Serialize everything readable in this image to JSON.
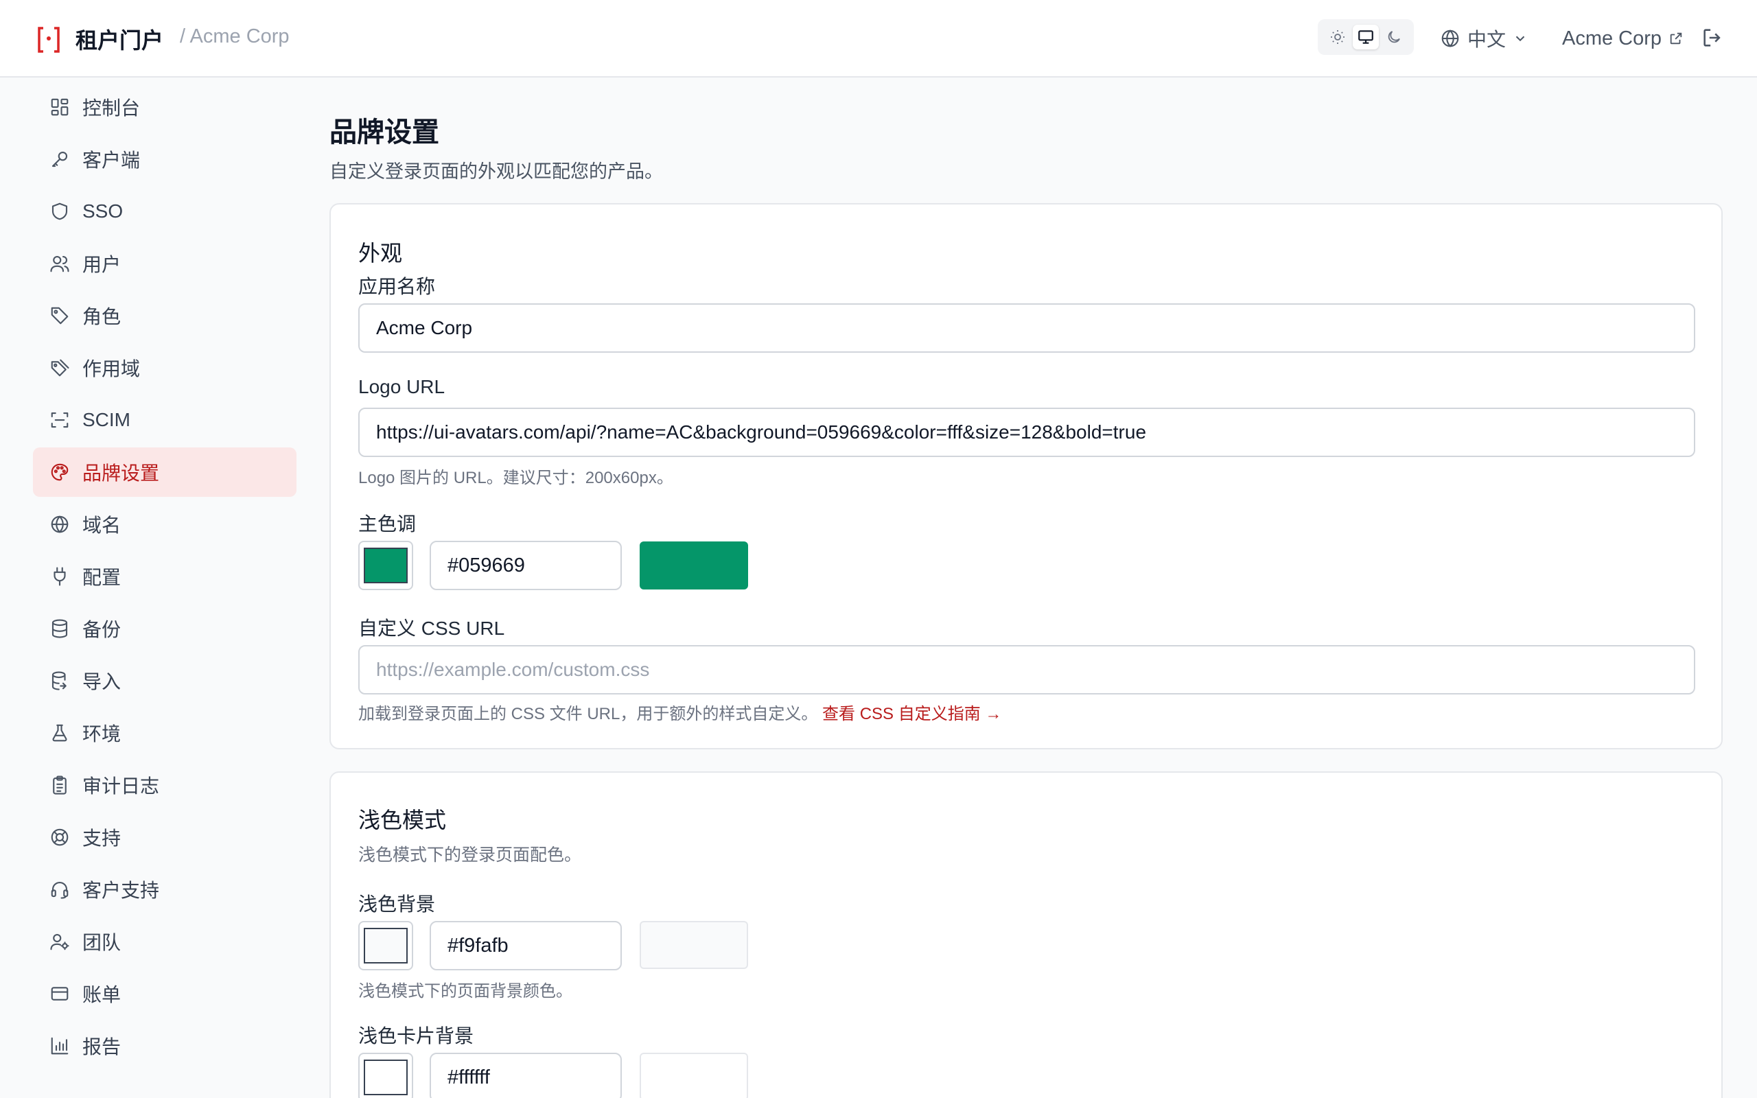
{
  "header": {
    "brand_title": "租户门户",
    "breadcrumb": "/ Acme Corp",
    "theme_options": [
      "light",
      "system",
      "dark"
    ],
    "theme_active": "system",
    "language": "中文",
    "tenant_link": "Acme Corp"
  },
  "sidebar": {
    "items": [
      {
        "label": "控制台",
        "icon": "dashboard-icon"
      },
      {
        "label": "客户端",
        "icon": "key-icon"
      },
      {
        "label": "SSO",
        "icon": "shield-icon"
      },
      {
        "label": "用户",
        "icon": "users-icon"
      },
      {
        "label": "角色",
        "icon": "tag-icon"
      },
      {
        "label": "作用域",
        "icon": "tags-icon"
      },
      {
        "label": "SCIM",
        "icon": "scan-icon"
      },
      {
        "label": "品牌设置",
        "icon": "palette-icon",
        "active": true
      },
      {
        "label": "域名",
        "icon": "globe-icon"
      },
      {
        "label": "配置",
        "icon": "plug-icon"
      },
      {
        "label": "备份",
        "icon": "database-icon"
      },
      {
        "label": "导入",
        "icon": "database-import-icon"
      },
      {
        "label": "环境",
        "icon": "flask-icon"
      },
      {
        "label": "审计日志",
        "icon": "clipboard-icon"
      },
      {
        "label": "支持",
        "icon": "lifebuoy-icon"
      },
      {
        "label": "客户支持",
        "icon": "headset-icon"
      },
      {
        "label": "团队",
        "icon": "team-icon"
      },
      {
        "label": "账单",
        "icon": "credit-card-icon"
      },
      {
        "label": "报告",
        "icon": "bar-chart-icon"
      }
    ]
  },
  "main": {
    "title": "品牌设置",
    "description": "自定义登录页面的外观以匹配您的产品。",
    "appearance": {
      "title": "外观",
      "app_name_label": "应用名称",
      "app_name_value": "Acme Corp",
      "logo_label": "Logo URL",
      "logo_value": "https://ui-avatars.com/api/?name=AC&background=059669&color=fff&size=128&bold=true",
      "logo_help": "Logo 图片的 URL。建议尺寸：200x60px。",
      "primary_label": "主色调",
      "primary_value": "#059669",
      "css_label": "自定义 CSS URL",
      "css_placeholder": "https://example.com/custom.css",
      "css_help": "加载到登录页面上的 CSS 文件 URL，用于额外的样式自定义。",
      "css_help_link": "查看 CSS 自定义指南 →"
    },
    "light_mode": {
      "title": "浅色模式",
      "description": "浅色模式下的登录页面配色。",
      "bg_label": "浅色背景",
      "bg_value": "#f9fafb",
      "bg_help": "浅色模式下的页面背景颜色。",
      "card_bg_label": "浅色卡片背景",
      "card_bg_value": "#ffffff"
    }
  },
  "colors": {
    "accent": "#b91c1c",
    "active_bg": "#fbe7e7",
    "primary": "#059669",
    "light_bg": "#f9fafb",
    "card_bg": "#ffffff"
  }
}
